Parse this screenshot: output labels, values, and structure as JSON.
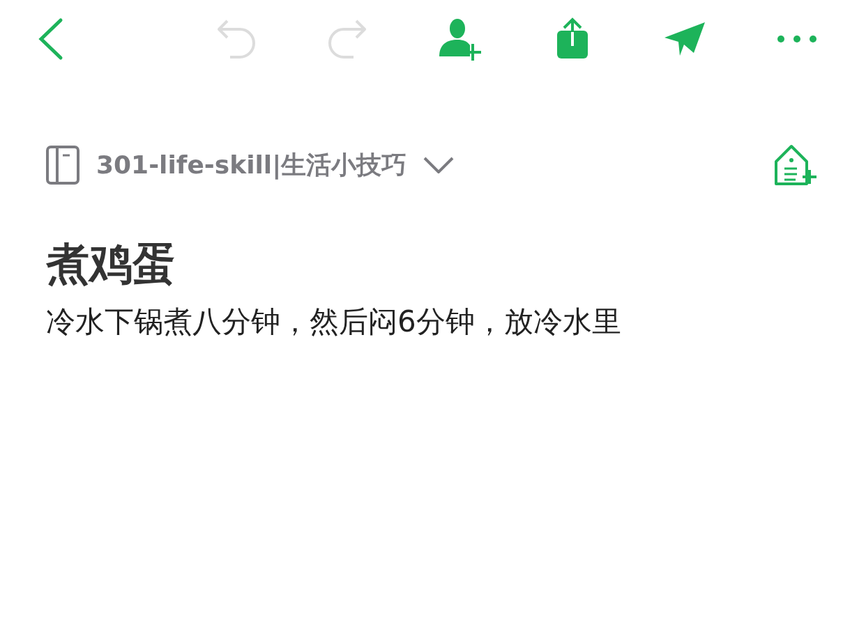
{
  "toolbar": [
    {
      "kind": "back",
      "disabled": false
    },
    {
      "kind": "undo",
      "disabled": true
    },
    {
      "kind": "redo",
      "disabled": true
    },
    {
      "kind": "add-person",
      "disabled": false
    },
    {
      "kind": "share",
      "disabled": false
    },
    {
      "kind": "send",
      "disabled": false
    },
    {
      "kind": "more",
      "disabled": false
    }
  ],
  "notebook": {
    "name": "301-life-skill|生活小技巧"
  },
  "note": {
    "title": "煮鸡蛋",
    "body": "冷水下锅煮八分钟，然后闷6分钟，放冷水里"
  }
}
